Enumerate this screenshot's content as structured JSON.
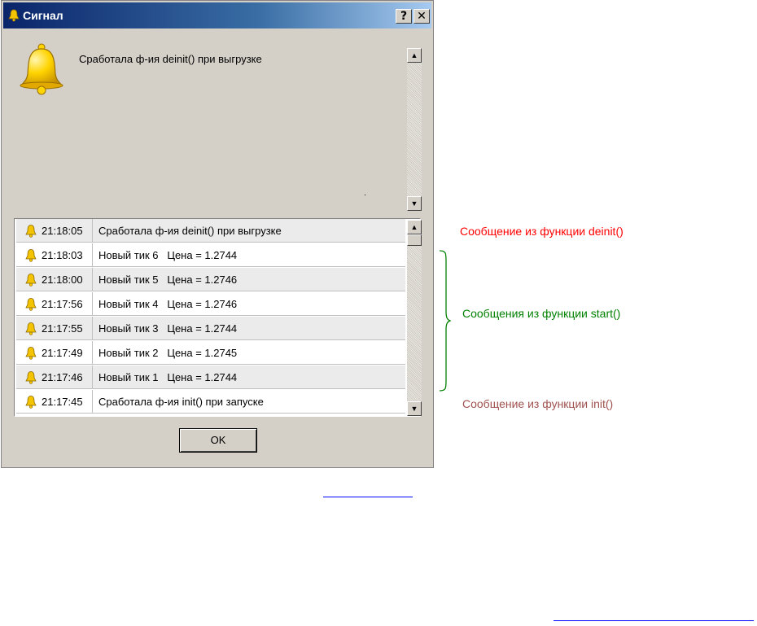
{
  "window": {
    "title": "Сигнал",
    "help_label": "?",
    "close_label": "✕",
    "message": "Сработала ф-ия deinit() при выгрузке"
  },
  "log": [
    {
      "time": "21:18:05",
      "msg": "Сработала ф-ия deinit() при выгрузке"
    },
    {
      "time": "21:18:03",
      "msg": "Новый тик 6   Цена = 1.2744"
    },
    {
      "time": "21:18:00",
      "msg": "Новый тик 5   Цена = 1.2746"
    },
    {
      "time": "21:17:56",
      "msg": "Новый тик 4   Цена = 1.2746"
    },
    {
      "time": "21:17:55",
      "msg": "Новый тик 3   Цена = 1.2744"
    },
    {
      "time": "21:17:49",
      "msg": "Новый тик 2   Цена = 1.2745"
    },
    {
      "time": "21:17:46",
      "msg": "Новый тик 1   Цена = 1.2744"
    },
    {
      "time": "21:17:45",
      "msg": "Сработала ф-ия init() при запуске"
    }
  ],
  "ok_label": "OK",
  "annotations": {
    "deinit": "Сообщение из функции deinit()",
    "start": "Сообщения из функции start()",
    "init": "Сообщение из функции  init()"
  },
  "colors": {
    "deinit": "#ff0000",
    "start": "#008000",
    "init": "#a0524e"
  },
  "icons": {
    "title": "bell-icon",
    "message": "bell-icon",
    "row": "bell-icon"
  }
}
